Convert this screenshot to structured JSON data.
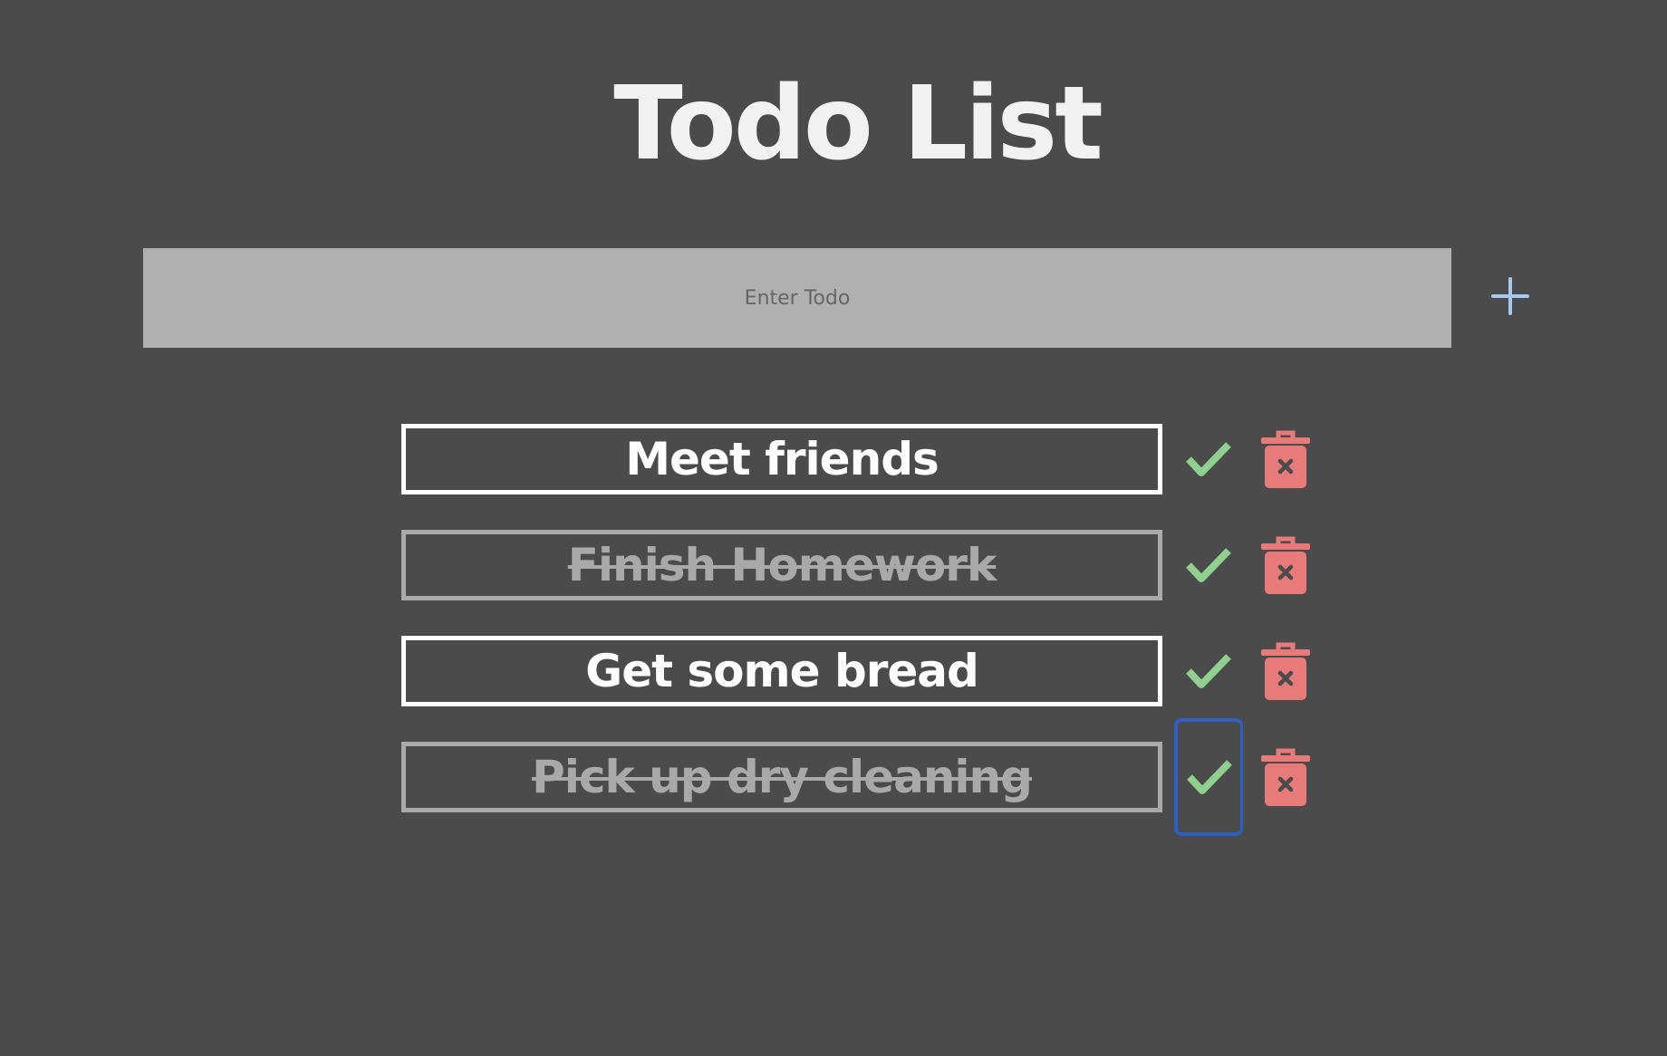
{
  "app": {
    "title": "Todo List"
  },
  "input": {
    "placeholder": "Enter Todo",
    "value": ""
  },
  "todos": [
    {
      "text": "Meet friends",
      "completed": false
    },
    {
      "text": "Finish Homework",
      "completed": true
    },
    {
      "text": "Get some bread",
      "completed": false
    },
    {
      "text": "Pick up dry cleaning",
      "completed": true
    }
  ],
  "icons": {
    "add": "plus-icon",
    "complete": "check-icon",
    "delete": "trash-icon"
  },
  "colors": {
    "background": "#4b4b4b",
    "input_background": "#b0b0b0",
    "add_icon": "#a9c8f0",
    "check_icon": "#8fcf8f",
    "trash_icon": "#e87a7a",
    "completed_text": "#a9a9a9",
    "focus_ring": "#2f5fc5"
  }
}
